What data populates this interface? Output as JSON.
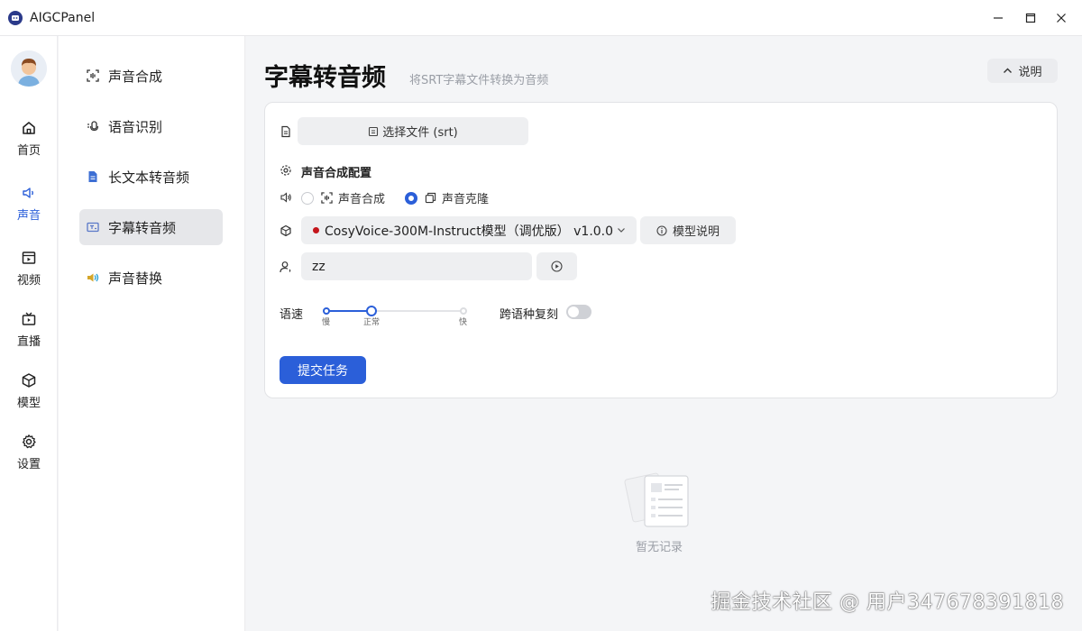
{
  "window": {
    "title": "AIGCPanel",
    "controls": [
      "minimize-icon",
      "maximize-icon",
      "close-icon"
    ]
  },
  "rail": {
    "items": [
      {
        "label": "首页",
        "icon": "home-icon"
      },
      {
        "label": "声音",
        "icon": "speaker-icon",
        "active": true
      },
      {
        "label": "视频",
        "icon": "video-icon"
      },
      {
        "label": "直播",
        "icon": "tv-icon"
      },
      {
        "label": "模型",
        "icon": "cube-icon"
      },
      {
        "label": "设置",
        "icon": "gear-icon"
      }
    ]
  },
  "submenu": {
    "items": [
      {
        "label": "声音合成",
        "icon": "scan-voice-icon"
      },
      {
        "label": "语音识别",
        "icon": "speech-recognition-icon"
      },
      {
        "label": "长文本转音频",
        "icon": "document-icon"
      },
      {
        "label": "字幕转音频",
        "icon": "subtitle-icon",
        "active": true
      },
      {
        "label": "声音替换",
        "icon": "sound-replace-icon"
      }
    ]
  },
  "page": {
    "title": "字幕转音频",
    "subtitle": "将SRT字幕文件转换为音频",
    "help_label": "说明"
  },
  "form": {
    "file_button": "选择文件 (srt)",
    "config_label": "声音合成配置",
    "modes": [
      {
        "label": "声音合成",
        "checked": false
      },
      {
        "label": "声音克隆",
        "checked": true
      }
    ],
    "model_value": "CosyVoice-300M-Instruct模型（调优版） v1.0.0",
    "model_help": "模型说明",
    "voice_value": "zz",
    "speed_label": "语速",
    "speed_ticks": [
      "慢",
      "正常",
      "快"
    ],
    "speed_value": "正常",
    "cross_lingual_label": "跨语种复刻",
    "cross_lingual_enabled": false,
    "submit_label": "提交任务"
  },
  "empty": {
    "text": "暂无记录"
  },
  "watermark": "掘金技术社区 @ 用户347678391818",
  "colors": {
    "accent": "#2b5fd9",
    "model_dot": "#c4161c"
  }
}
